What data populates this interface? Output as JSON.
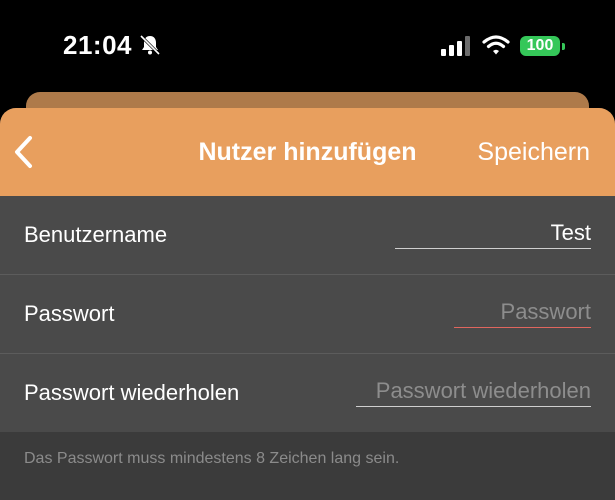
{
  "status_bar": {
    "time": "21:04",
    "battery": "100",
    "icons": [
      "bell-slash-icon",
      "cellular-signal-icon",
      "wifi-icon",
      "battery-icon"
    ]
  },
  "nav": {
    "title": "Nutzer hinzufügen",
    "save_label": "Speichern",
    "back_icon": "chevron-left-icon",
    "accent_color": "#e89f5e"
  },
  "form": {
    "username": {
      "label": "Benutzername",
      "value": "Test",
      "placeholder": ""
    },
    "password": {
      "label": "Passwort",
      "value": "",
      "placeholder": "Passwort"
    },
    "password_repeat": {
      "label": "Passwort wiederholen",
      "value": "",
      "placeholder": "Passwort wiederholen"
    }
  },
  "hint": "Das Passwort muss mindestens 8 Zeichen lang sein.",
  "colors": {
    "error_underline": "#e0665e",
    "battery": "#35c759"
  }
}
